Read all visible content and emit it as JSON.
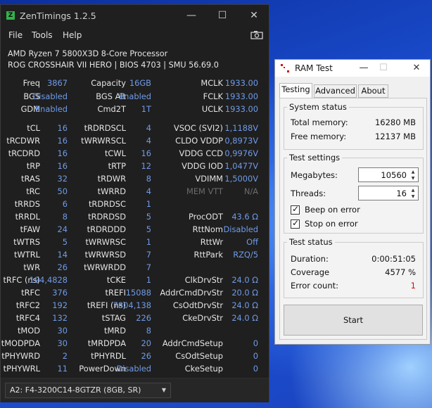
{
  "zentimings": {
    "title": "ZenTimings 1.2.5",
    "logo_glyph": "Z",
    "window_buttons": {
      "minimize": "—",
      "maximize": "☐",
      "close": "✕"
    },
    "menu": {
      "file": "File",
      "tools": "Tools",
      "help": "Help"
    },
    "screenshot_icon": "camera-icon",
    "cpu_name": "AMD Ryzen 7 5800X3D 8-Core Processor",
    "board_info": "ROG CROSSHAIR VII HERO | BIOS 4703 | SMU 56.69.0",
    "top_table": [
      [
        "Freq",
        "3867",
        "Capacity",
        "16GB",
        "MCLK",
        "1933.00"
      ],
      [
        "BGS",
        "Disabled",
        "BGS Alt",
        "Enabled",
        "FCLK",
        "1933.00"
      ],
      [
        "GDM",
        "Enabled",
        "Cmd2T",
        "1T",
        "UCLK",
        "1933.00"
      ]
    ],
    "timings": [
      [
        "tCL",
        "16",
        "tRDRDSCL",
        "4",
        "VSOC (SVI2)",
        "1,1188V"
      ],
      [
        "tRCDWR",
        "16",
        "tWRWRSCL",
        "4",
        "CLDO VDDP",
        "0,8973V"
      ],
      [
        "tRCDRD",
        "16",
        "tCWL",
        "16",
        "VDDG CCD",
        "0,9976V"
      ],
      [
        "tRP",
        "16",
        "tRTP",
        "12",
        "VDDG IOD",
        "1,0477V"
      ],
      [
        "tRAS",
        "32",
        "tRDWR",
        "8",
        "VDIMM",
        "1,5000V"
      ],
      [
        "tRC",
        "50",
        "tWRRD",
        "4",
        "MEM VTT",
        "N/A"
      ],
      [
        "tRRDS",
        "6",
        "tRDRDSC",
        "1",
        "",
        ""
      ],
      [
        "tRRDL",
        "8",
        "tRDRDSD",
        "5",
        "ProcODT",
        "43.6 Ω"
      ],
      [
        "tFAW",
        "24",
        "tRDRDDD",
        "5",
        "RttNom",
        "Disabled"
      ],
      [
        "tWTRS",
        "5",
        "tWRWRSC",
        "1",
        "RttWr",
        "Off"
      ],
      [
        "tWTRL",
        "14",
        "tWRWRSD",
        "7",
        "RttPark",
        "RZQ/5"
      ],
      [
        "tWR",
        "26",
        "tWRWRDD",
        "7",
        "",
        ""
      ],
      [
        "tRFC (ns)",
        "194,4828",
        "tCKE",
        "1",
        "ClkDrvStr",
        "24.0 Ω"
      ],
      [
        "tRFC",
        "376",
        "tREFI",
        "15088",
        "AddrCmdDrvStr",
        "20.0 Ω"
      ],
      [
        "tRFC2",
        "192",
        "tREFI (ns)",
        "7804,138",
        "CsOdtDrvStr",
        "24.0 Ω"
      ],
      [
        "tRFC4",
        "132",
        "tSTAG",
        "226",
        "CkeDrvStr",
        "24.0 Ω"
      ],
      [
        "tMOD",
        "30",
        "tMRD",
        "8",
        "",
        ""
      ],
      [
        "tMODPDA",
        "30",
        "tMRDPDA",
        "20",
        "AddrCmdSetup",
        "0"
      ],
      [
        "tPHYWRD",
        "2",
        "tPHYRDL",
        "26",
        "CsOdtSetup",
        "0"
      ],
      [
        "tPHYWRL",
        "11",
        "PowerDown",
        "Disabled",
        "CkeSetup",
        "0"
      ]
    ],
    "dimm_selected": "A2: F4-3200C14-8GTZR (8GB, SR)",
    "colors": {
      "value": "#6f9be8",
      "label": "#e4e4e4",
      "dim": "#6c6c6c",
      "background": "#1f1f1f"
    }
  },
  "ramtest": {
    "title": "RAM Test",
    "window_buttons": {
      "minimize": "—",
      "maximize": "☐",
      "close": "✕"
    },
    "tabs": [
      "Testing",
      "Advanced",
      "About"
    ],
    "system_status": {
      "title": "System status",
      "total_memory_label": "Total memory:",
      "total_memory_value": "16280 MB",
      "free_memory_label": "Free memory:",
      "free_memory_value": "12137 MB"
    },
    "test_settings": {
      "title": "Test settings",
      "megabytes_label": "Megabytes:",
      "megabytes_value": "10560",
      "threads_label": "Threads:",
      "threads_value": "16",
      "beep_label": "Beep on error",
      "stop_label": "Stop on error"
    },
    "test_status": {
      "title": "Test status",
      "duration_label": "Duration:",
      "duration_value": "0:00:51:05",
      "coverage_label": "Coverage",
      "coverage_value": "4577 %",
      "error_label": "Error count:",
      "error_value": "1"
    },
    "start_label": "Start",
    "colors": {
      "error": "#d01010"
    }
  }
}
